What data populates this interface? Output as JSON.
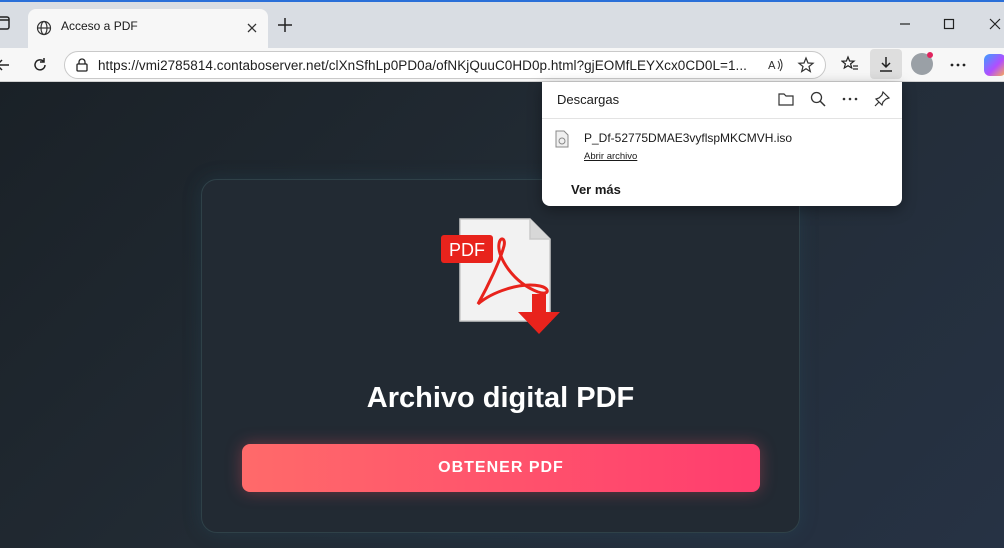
{
  "tab": {
    "title": "Acceso a PDF"
  },
  "address_bar": {
    "url": "https://vmi2785814.contaboserver.net/clXnSfhLp0PD0a/ofNKjQuuC0HD0p.html?gjEOMfLEYXcx0CD0L=1..."
  },
  "page": {
    "pdf_badge": "PDF",
    "heading": "Archivo digital PDF",
    "cta_label": "OBTENER PDF"
  },
  "downloads": {
    "title": "Descargas",
    "file_name": "P_Df-52775DMAE3vyflspMKCMVH.iso",
    "open_file_label": "Abrir archivo",
    "see_more_label": "Ver más"
  },
  "colors": {
    "accent_start": "#ff6a6a",
    "accent_end": "#ff3d6e",
    "pdf_red": "#e8231c"
  },
  "icons": [
    "tab-actions-icon",
    "globe-icon",
    "close-icon",
    "plus-icon",
    "minimize-icon",
    "maximize-icon",
    "back-icon",
    "refresh-icon",
    "lock-icon",
    "read-aloud-icon",
    "star-icon",
    "favorites-icon",
    "download-icon",
    "profile-icon",
    "more-icon",
    "copilot-icon",
    "folder-icon",
    "search-icon",
    "pin-icon",
    "file-icon",
    "pdf-download-icon"
  ]
}
